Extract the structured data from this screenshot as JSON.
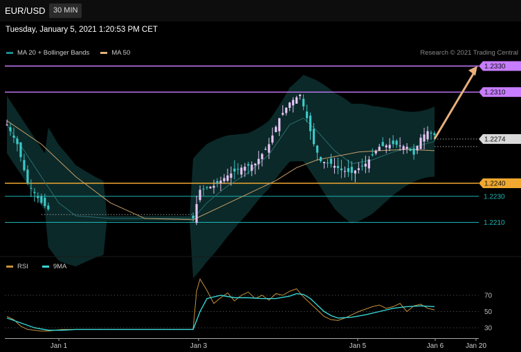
{
  "header": {
    "symbol": "EUR/USD",
    "timeframe": "30 MIN"
  },
  "datetime": "Tuesday, January 5, 2021 1:20:53 PM CET",
  "research": "Research © 2021 Trading Central",
  "legend": [
    {
      "label": "MA 20 + Bollinger Bands",
      "color": "#1a8c8c"
    },
    {
      "label": "MA 50",
      "color": "#e0b27a"
    }
  ],
  "rsi_legend": [
    {
      "label": "RSI",
      "color": "#c8923c"
    },
    {
      "label": "9MA",
      "color": "#36d6d6"
    }
  ],
  "colors": {
    "resistance": "#c77dff",
    "support": "#1fb5b5",
    "pivot": "#f0a830",
    "arrow": "#e8b07c",
    "candle_up": "#e6c4f4",
    "candle_down": "#3ec8c8"
  },
  "chart_data": [
    {
      "type": "candlestick",
      "x_ticks": [
        "Jan 1",
        "Jan 3",
        "Jan 5",
        "Jan 6",
        "Jan 20"
      ],
      "ylim": [
        1.2177,
        1.2352
      ],
      "levels": [
        {
          "value": 1.233,
          "label": "1.2330",
          "role": "resistance"
        },
        {
          "value": 1.231,
          "label": "1.2310",
          "role": "resistance"
        },
        {
          "value": 1.2274,
          "label": "1.2274",
          "role": "last"
        },
        {
          "value": 1.224,
          "label": "1.2240",
          "role": "pivot"
        },
        {
          "value": 1.223,
          "label": "1.2230",
          "role": "support"
        },
        {
          "value": 1.221,
          "label": "1.2210",
          "role": "support"
        }
      ],
      "close_path": [
        [
          0,
          1.2285
        ],
        [
          3,
          1.227
        ],
        [
          6,
          1.224
        ],
        [
          10,
          1.2225
        ],
        [
          14,
          1.2215
        ],
        [
          18,
          1.2212
        ],
        [
          22,
          1.2214
        ],
        [
          30,
          1.2212
        ],
        [
          40,
          1.2212
        ],
        [
          54,
          1.2213
        ],
        [
          56,
          1.2235
        ],
        [
          60,
          1.2238
        ],
        [
          64,
          1.2246
        ],
        [
          68,
          1.2252
        ],
        [
          72,
          1.2255
        ],
        [
          76,
          1.227
        ],
        [
          79,
          1.229
        ],
        [
          82,
          1.2302
        ],
        [
          85,
          1.2308
        ],
        [
          87,
          1.229
        ],
        [
          89,
          1.227
        ],
        [
          91,
          1.2257
        ],
        [
          94,
          1.2255
        ],
        [
          97,
          1.225
        ],
        [
          100,
          1.2248
        ],
        [
          104,
          1.2255
        ],
        [
          108,
          1.2268
        ],
        [
          112,
          1.227
        ],
        [
          116,
          1.2268
        ],
        [
          118,
          1.2262
        ],
        [
          120,
          1.2275
        ],
        [
          122,
          1.228
        ],
        [
          124,
          1.2277
        ]
      ],
      "ma20": [
        [
          0,
          1.2285
        ],
        [
          5,
          1.2265
        ],
        [
          10,
          1.2245
        ],
        [
          15,
          1.2225
        ],
        [
          20,
          1.2215
        ],
        [
          30,
          1.2213
        ],
        [
          54,
          1.2213
        ],
        [
          58,
          1.2225
        ],
        [
          64,
          1.2238
        ],
        [
          70,
          1.2248
        ],
        [
          76,
          1.2262
        ],
        [
          82,
          1.2285
        ],
        [
          86,
          1.229
        ],
        [
          90,
          1.228
        ],
        [
          95,
          1.2265
        ],
        [
          100,
          1.2255
        ],
        [
          106,
          1.2258
        ],
        [
          112,
          1.2264
        ],
        [
          118,
          1.2268
        ],
        [
          124,
          1.2272
        ]
      ],
      "ma50": [
        [
          0,
          1.2288
        ],
        [
          10,
          1.227
        ],
        [
          20,
          1.2245
        ],
        [
          30,
          1.2225
        ],
        [
          40,
          1.2213
        ],
        [
          54,
          1.2212
        ],
        [
          62,
          1.2222
        ],
        [
          70,
          1.2232
        ],
        [
          78,
          1.2242
        ],
        [
          84,
          1.2252
        ],
        [
          90,
          1.2258
        ],
        [
          96,
          1.2261
        ],
        [
          102,
          1.2264
        ],
        [
          108,
          1.2265
        ],
        [
          116,
          1.2266
        ],
        [
          124,
          1.2265
        ]
      ],
      "forecast": [
        [
          124,
          1.2274
        ],
        [
          137,
          1.233
        ]
      ]
    },
    {
      "type": "line",
      "name": "RSI",
      "x_ticks": [
        "Jan 1",
        "Jan 3",
        "Jan 5",
        "Jan 6",
        "Jan 20"
      ],
      "y_ticks": [
        70,
        50,
        30
      ],
      "ylim": [
        10,
        100
      ],
      "series": [
        {
          "name": "RSI",
          "x": [
            0,
            2,
            4,
            6,
            8,
            10,
            12,
            14,
            16,
            20,
            30,
            40,
            54,
            55,
            56,
            58,
            60,
            62,
            64,
            66,
            68,
            70,
            72,
            74,
            76,
            78,
            80,
            82,
            84,
            86,
            88,
            90,
            92,
            94,
            96,
            98,
            100,
            102,
            104,
            106,
            108,
            110,
            112,
            114,
            116,
            118,
            120,
            122,
            124
          ],
          "values": [
            44,
            40,
            32,
            28,
            27,
            26,
            26,
            27,
            28,
            28,
            28,
            28,
            28,
            75,
            90,
            76,
            60,
            67,
            73,
            63,
            70,
            74,
            66,
            70,
            64,
            72,
            70,
            75,
            78,
            68,
            60,
            52,
            44,
            40,
            39,
            42,
            46,
            50,
            53,
            56,
            58,
            54,
            56,
            60,
            50,
            57,
            59,
            54,
            52
          ]
        },
        {
          "name": "9MA",
          "x": [
            0,
            4,
            8,
            12,
            16,
            20,
            30,
            40,
            54,
            56,
            58,
            62,
            66,
            70,
            74,
            78,
            82,
            84,
            86,
            88,
            90,
            92,
            94,
            96,
            100,
            104,
            108,
            112,
            116,
            120,
            124
          ],
          "values": [
            42,
            36,
            30,
            27,
            27,
            28,
            28,
            28,
            28,
            50,
            66,
            70,
            67,
            67,
            66,
            66,
            69,
            72,
            71,
            66,
            58,
            50,
            45,
            42,
            43,
            46,
            50,
            54,
            56,
            57,
            56
          ]
        }
      ]
    }
  ]
}
